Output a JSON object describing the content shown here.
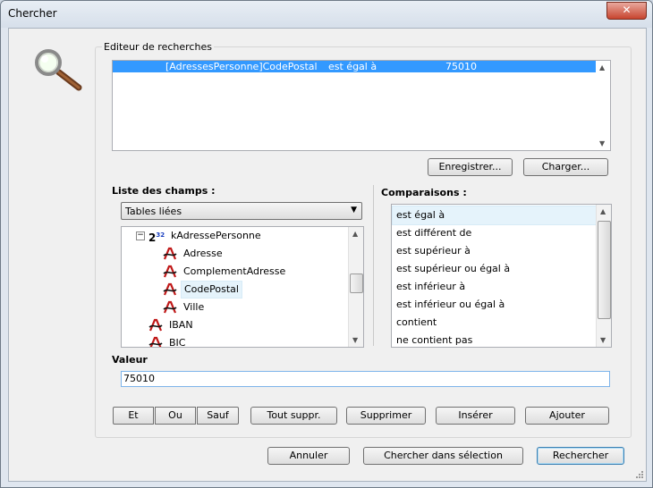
{
  "window": {
    "title": "Chercher",
    "close_symbol": "✕"
  },
  "search_editor": {
    "label": "Editeur de recherches",
    "rows": [
      {
        "field": "[AdressesPersonne]CodePostal",
        "comparison": "est égal à",
        "value": "75010"
      }
    ],
    "save_button": "Enregistrer...",
    "load_button": "Charger..."
  },
  "fields": {
    "label": "Liste des champs :",
    "dropdown_value": "Tables liées",
    "tree": [
      {
        "label": "kAdressePersonne",
        "icon": "integer-field-icon"
      },
      {
        "label": "Adresse",
        "icon": "text-field-icon"
      },
      {
        "label": "ComplementAdresse",
        "icon": "text-field-icon"
      },
      {
        "label": "CodePostal",
        "icon": "text-field-icon"
      },
      {
        "label": "Ville",
        "icon": "text-field-icon"
      },
      {
        "label": "IBAN",
        "icon": "text-field-icon"
      },
      {
        "label": "BIC",
        "icon": "text-field-icon"
      }
    ],
    "selected": "CodePostal"
  },
  "comparisons": {
    "label": "Comparaisons :",
    "items": [
      "est égal à",
      "est différent de",
      "est supérieur à",
      "est supérieur ou égal à",
      "est inférieur à",
      "est inférieur ou égal à",
      "contient",
      "ne contient pas"
    ],
    "selected": "est égal à"
  },
  "value": {
    "label": "Valeur",
    "current": "75010"
  },
  "logic_buttons": [
    "Et",
    "Ou",
    "Sauf"
  ],
  "edit_buttons": {
    "clear_all": "Tout suppr.",
    "delete": "Supprimer",
    "insert": "Insérer",
    "add": "Ajouter"
  },
  "footer": {
    "cancel": "Annuler",
    "search_selection": "Chercher dans sélection",
    "search": "Rechercher"
  },
  "colors": {
    "selection": "#3399ff",
    "hover": "#e5f3fb",
    "close": "#c7452f"
  }
}
